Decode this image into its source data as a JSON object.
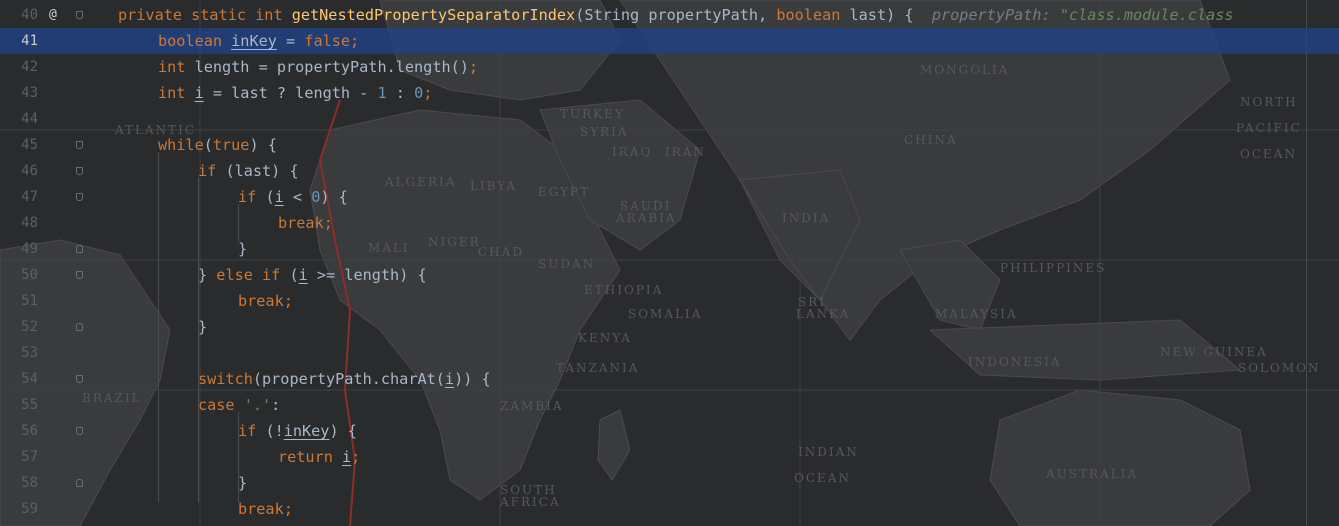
{
  "editor": {
    "lines": [
      {
        "num": "40",
        "mark": "@",
        "fold": "start",
        "indent": 0,
        "tokens": [
          {
            "t": "private static int ",
            "c": "kw"
          },
          {
            "t": "getNestedPropertySeparatorIndex",
            "c": "fn"
          },
          {
            "t": "(String propertyPath, "
          },
          {
            "t": "boolean ",
            "c": "kw"
          },
          {
            "t": "last) {  "
          },
          {
            "t": "propertyPath: ",
            "c": "hint"
          },
          {
            "t": "\"class.module.class",
            "c": "hintv"
          }
        ]
      },
      {
        "num": "41",
        "current": true,
        "indent": 1,
        "tokens": [
          {
            "t": "boolean ",
            "c": "kw"
          },
          {
            "t": "inKey",
            "c": "ul"
          },
          {
            "t": " = "
          },
          {
            "t": "false",
            "c": "kw"
          },
          {
            "t": ";",
            "c": "kw"
          }
        ]
      },
      {
        "num": "42",
        "indent": 1,
        "tokens": [
          {
            "t": "int ",
            "c": "kw"
          },
          {
            "t": "length = propertyPath.length()"
          },
          {
            "t": ";",
            "c": "kw"
          }
        ]
      },
      {
        "num": "43",
        "indent": 1,
        "tokens": [
          {
            "t": "int ",
            "c": "kw"
          },
          {
            "t": "i",
            "c": "ul"
          },
          {
            "t": " = last ? length - "
          },
          {
            "t": "1",
            "c": "num"
          },
          {
            "t": " : "
          },
          {
            "t": "0",
            "c": "num"
          },
          {
            "t": ";",
            "c": "kw"
          }
        ]
      },
      {
        "num": "44",
        "indent": 0,
        "tokens": []
      },
      {
        "num": "45",
        "fold": "start",
        "indent": 1,
        "tokens": [
          {
            "t": "while",
            "c": "kw"
          },
          {
            "t": "("
          },
          {
            "t": "true",
            "c": "kw"
          },
          {
            "t": ") {"
          }
        ]
      },
      {
        "num": "46",
        "fold": "start",
        "indent": 2,
        "tokens": [
          {
            "t": "if ",
            "c": "kw"
          },
          {
            "t": "(last) {"
          }
        ]
      },
      {
        "num": "47",
        "fold": "start",
        "indent": 3,
        "tokens": [
          {
            "t": "if ",
            "c": "kw"
          },
          {
            "t": "("
          },
          {
            "t": "i",
            "c": "ul"
          },
          {
            "t": " < "
          },
          {
            "t": "0",
            "c": "num"
          },
          {
            "t": ") {"
          }
        ]
      },
      {
        "num": "48",
        "indent": 4,
        "tokens": [
          {
            "t": "break;",
            "c": "kw"
          }
        ]
      },
      {
        "num": "49",
        "fold": "end",
        "indent": 3,
        "tokens": [
          {
            "t": "}"
          }
        ]
      },
      {
        "num": "50",
        "fold": "start",
        "indent": 2,
        "tokens": [
          {
            "t": "} "
          },
          {
            "t": "else if ",
            "c": "kw"
          },
          {
            "t": "("
          },
          {
            "t": "i",
            "c": "ul"
          },
          {
            "t": " >= length) {"
          }
        ]
      },
      {
        "num": "51",
        "indent": 3,
        "tokens": [
          {
            "t": "break;",
            "c": "kw"
          }
        ]
      },
      {
        "num": "52",
        "fold": "end",
        "indent": 2,
        "tokens": [
          {
            "t": "}"
          }
        ]
      },
      {
        "num": "53",
        "indent": 0,
        "tokens": []
      },
      {
        "num": "54",
        "fold": "start",
        "indent": 2,
        "tokens": [
          {
            "t": "switch",
            "c": "kw"
          },
          {
            "t": "(propertyPath.charAt("
          },
          {
            "t": "i",
            "c": "ul"
          },
          {
            "t": ")) {"
          }
        ]
      },
      {
        "num": "55",
        "indent": 2,
        "tokens": [
          {
            "t": "case ",
            "c": "kw"
          },
          {
            "t": "'.'",
            "c": "str"
          },
          {
            "t": ":"
          }
        ]
      },
      {
        "num": "56",
        "fold": "start",
        "indent": 3,
        "tokens": [
          {
            "t": "if ",
            "c": "kw"
          },
          {
            "t": "(!"
          },
          {
            "t": "inKey",
            "c": "ul"
          },
          {
            "t": ") {"
          }
        ]
      },
      {
        "num": "57",
        "indent": 4,
        "tokens": [
          {
            "t": "return ",
            "c": "kw"
          },
          {
            "t": "i",
            "c": "ul"
          },
          {
            "t": ";",
            "c": "kw"
          }
        ]
      },
      {
        "num": "58",
        "fold": "end",
        "indent": 3,
        "tokens": [
          {
            "t": "}"
          }
        ]
      },
      {
        "num": "59",
        "indent": 3,
        "tokens": [
          {
            "t": "break;",
            "c": "kw"
          }
        ]
      }
    ]
  },
  "background_map": {
    "labels": [
      "ATLANTIC",
      "BRAZIL",
      "ALGERIA",
      "LIBYA",
      "EGYPT",
      "SUDAN",
      "ETHIOPIA",
      "SOMALIA",
      "KENYA",
      "TANZANIA",
      "ZAMBIA",
      "IRAN",
      "TURKEY",
      "SYRIA",
      "IRAQ",
      "SAUDI",
      "ARABIA",
      "INDIA",
      "CHINA",
      "MONGOLIA",
      "NORTH",
      "PACIFIC",
      "OCEAN",
      "INDIAN",
      "OCEAN",
      "INDONESIA",
      "MALAYSIA",
      "PHILIPPINES",
      "AUSTRALIA",
      "NIGER",
      "CHAD",
      "MALI",
      "SRI",
      "LANKA",
      "SOUTH",
      "AFRICA",
      "NEW GUINEA",
      "SOLOMON"
    ]
  },
  "colors": {
    "keyword": "#cc7832",
    "function": "#ffc66d",
    "number": "#6897bb",
    "string": "#6a8759",
    "plain": "#a9b7c6",
    "current_line": "#214283"
  }
}
